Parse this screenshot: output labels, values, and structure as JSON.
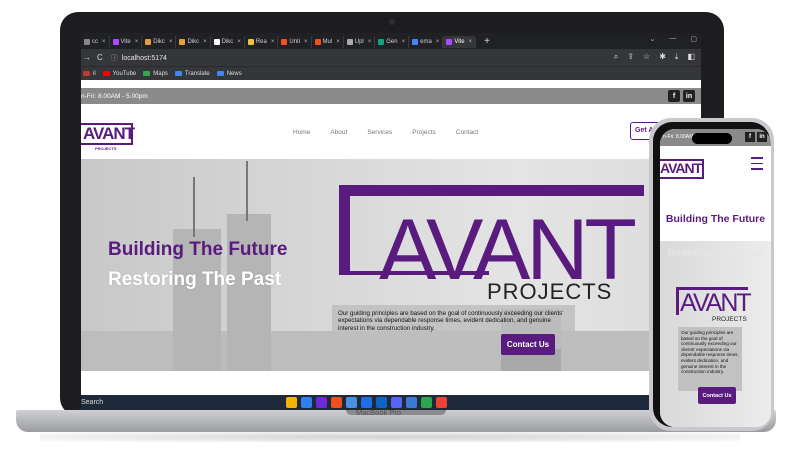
{
  "browser": {
    "tabs": [
      {
        "label": "cc",
        "color": "#888"
      },
      {
        "label": "Vite",
        "color": "#a64dff"
      },
      {
        "label": "Dikc",
        "color": "#e0a040"
      },
      {
        "label": "Dikc",
        "color": "#e0a040"
      },
      {
        "label": "Dikc",
        "color": "#ffffff"
      },
      {
        "label": "Rea",
        "color": "#f0c040"
      },
      {
        "label": "Unti",
        "color": "#f24e1e"
      },
      {
        "label": "Mul",
        "color": "#f24e1e"
      },
      {
        "label": "Upl",
        "color": "#aaaaaa"
      },
      {
        "label": "Gen",
        "color": "#10a37f"
      },
      {
        "label": "ema",
        "color": "#4285f4"
      },
      {
        "label": "Vite",
        "color": "#a64dff"
      }
    ],
    "close_glyph": "×",
    "new_tab": "+",
    "url": "localhost:5174",
    "bookmarks": [
      {
        "label": "il",
        "color": "#c0392b"
      },
      {
        "label": "YouTube",
        "color": "#ff0000"
      },
      {
        "label": "Maps",
        "color": "#34a853"
      },
      {
        "label": "Translate",
        "color": "#4285f4"
      },
      {
        "label": "News",
        "color": "#4285f4"
      }
    ]
  },
  "site": {
    "hours": "n-Fri: 8.00AM - 5.00pm",
    "logo": "AVANT",
    "logo_sub": "PROJECTS",
    "nav": [
      "Home",
      "About",
      "Services",
      "Projects",
      "Contact"
    ],
    "cta": "Get A",
    "hero_title": "Building The Future",
    "hero_sub": "Restoring The Past",
    "big_logo": "AVANT",
    "big_logo_sub": "PROJECTS",
    "info": "Our guiding principles are based on the goal of continuously exceeding our clients' expectations via dependable response times, evident dedication, and genuine interest in the construction industry.",
    "contact_btn": "Contact Us",
    "social": [
      "f",
      "in"
    ]
  },
  "taskbar": {
    "search": "Search"
  },
  "device": {
    "brand": "MacBook Pro"
  },
  "phone": {
    "hours": "n-Fri: 8.00AM",
    "logo": "AVANT",
    "hero_title": "Building The Future",
    "hero_sub": "Restoring The Past",
    "big_logo": "AVANT",
    "big_logo_sub": "PROJECTS",
    "info": "Our guiding principles are based on the goal of continuously exceeding our clients' expectations via dependable response times, evident dedication, and genuine interest in the construction industry.",
    "contact_btn": "Contact Us"
  },
  "colors": {
    "brand_purple": "#5a1b7e",
    "strip_gray": "#8a8a8a"
  }
}
